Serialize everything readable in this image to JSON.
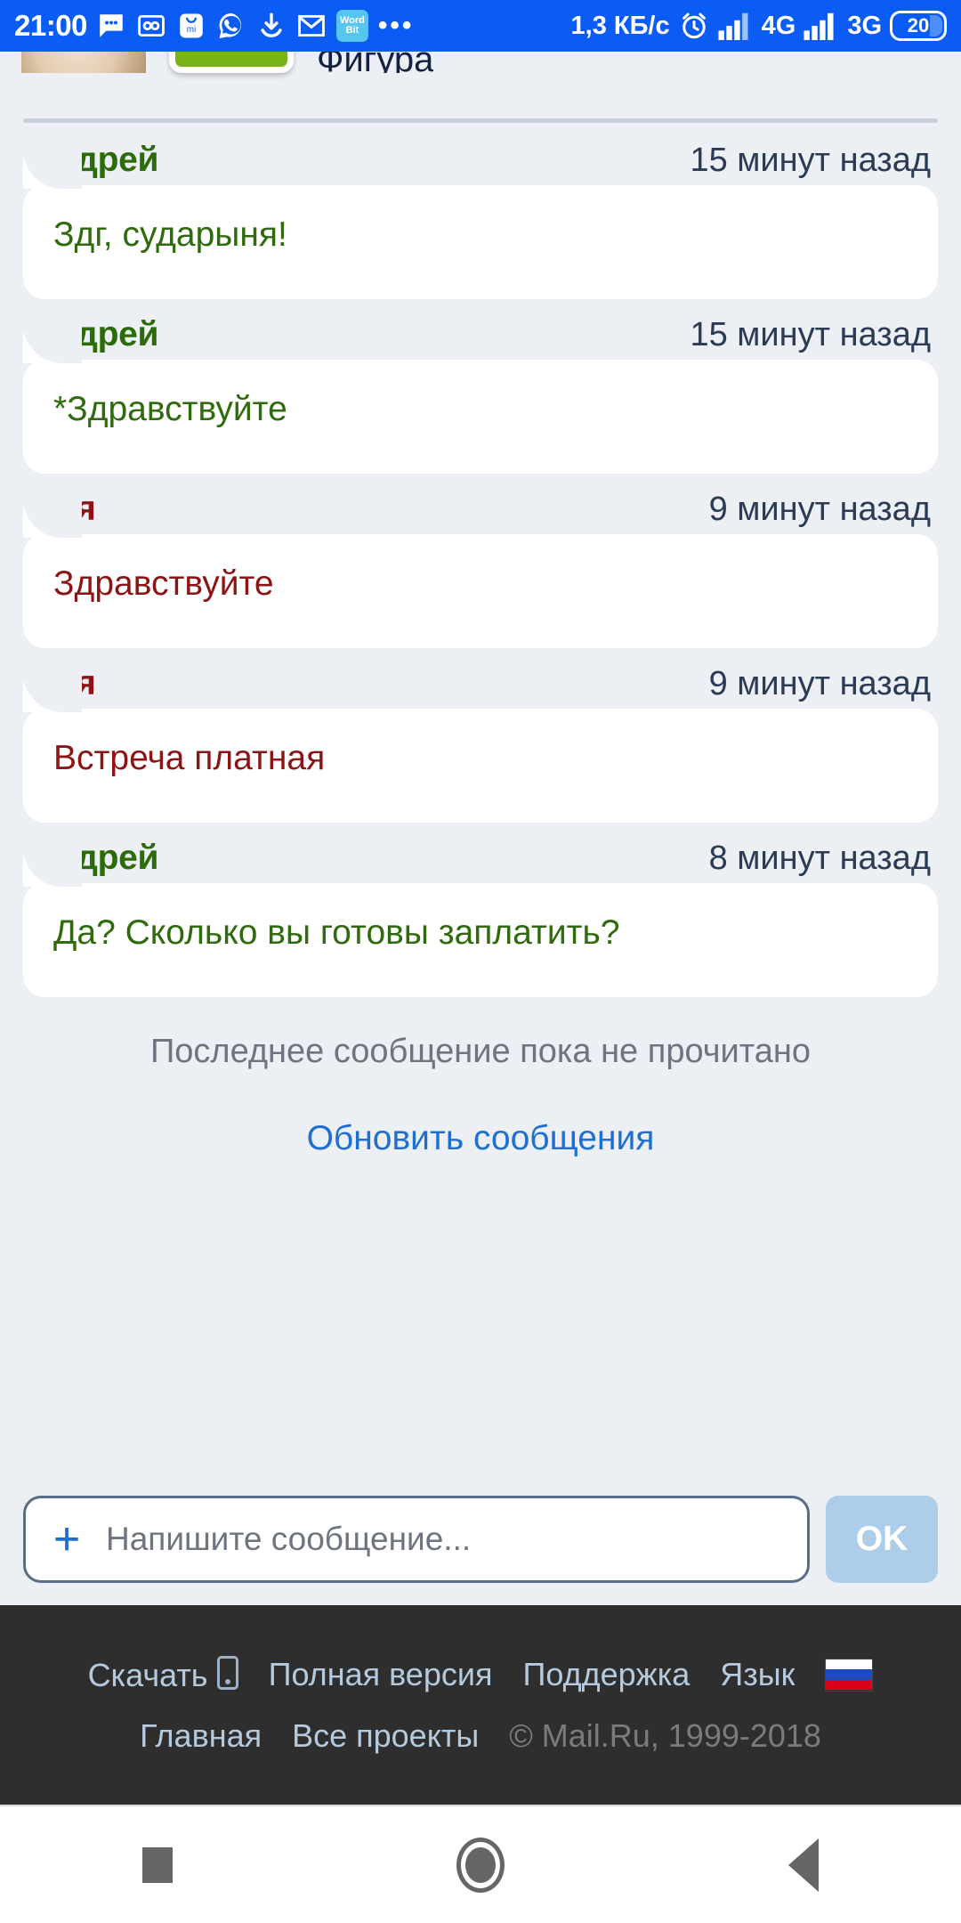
{
  "statusbar": {
    "clock": "21:00",
    "icons": [
      "sms-icon",
      "voicemail-icon",
      "mi-store-icon",
      "whatsapp-icon",
      "download-icon",
      "gmail-icon",
      "wordbit-icon"
    ],
    "wordbit_top": "Word",
    "wordbit_bottom": "Bit",
    "overflow": "•••",
    "data_speed": "1,3 КБ/с",
    "alarm": "alarm-icon",
    "net_primary": "4G",
    "net_secondary": "3G",
    "battery": "20"
  },
  "top_partial_row": {
    "avatar": "user-avatar",
    "button": "green-action-button",
    "cutoff_text": "Фигура"
  },
  "messages": [
    {
      "author": "Андрей",
      "time": "15 минут назад",
      "text": "Здг, сударыня!",
      "side": "green"
    },
    {
      "author": "Андрей",
      "time": "15 минут назад",
      "text": "*Здравствуйте",
      "side": "green"
    },
    {
      "author": "Эля",
      "time": "9 минут назад",
      "text": "Здравствуйте",
      "side": "red"
    },
    {
      "author": "Эля",
      "time": "9 минут назад",
      "text": "Встреча платная",
      "side": "red"
    },
    {
      "author": "Андрей",
      "time": "8 минут назад",
      "text": "Да? Сколько вы готовы заплатить?",
      "side": "green"
    }
  ],
  "notice": "Последнее сообщение пока не прочитано",
  "refresh_link": "Обновить сообщения",
  "composer": {
    "plus": "+",
    "placeholder": "Напишите сообщение...",
    "value": "",
    "ok_label": "OK"
  },
  "footer": {
    "row1": [
      "Скачать",
      "Полная версия",
      "Поддержка",
      "Язык"
    ],
    "row2_home": "Главная",
    "row2_projects": "Все проекты",
    "copyright": "© Mail.Ru, 1999-2018"
  },
  "navbar": {
    "recents": "recents-icon",
    "home": "home-icon",
    "back": "back-icon"
  },
  "colors": {
    "status_bar": "#0a5cf5",
    "page_bg": "#eceff4",
    "bubble": "#ffffff",
    "author_green": "#2b6b08",
    "author_red": "#8c1414",
    "link_blue": "#1f6fd0",
    "footer_bg": "#2e2e2e"
  }
}
